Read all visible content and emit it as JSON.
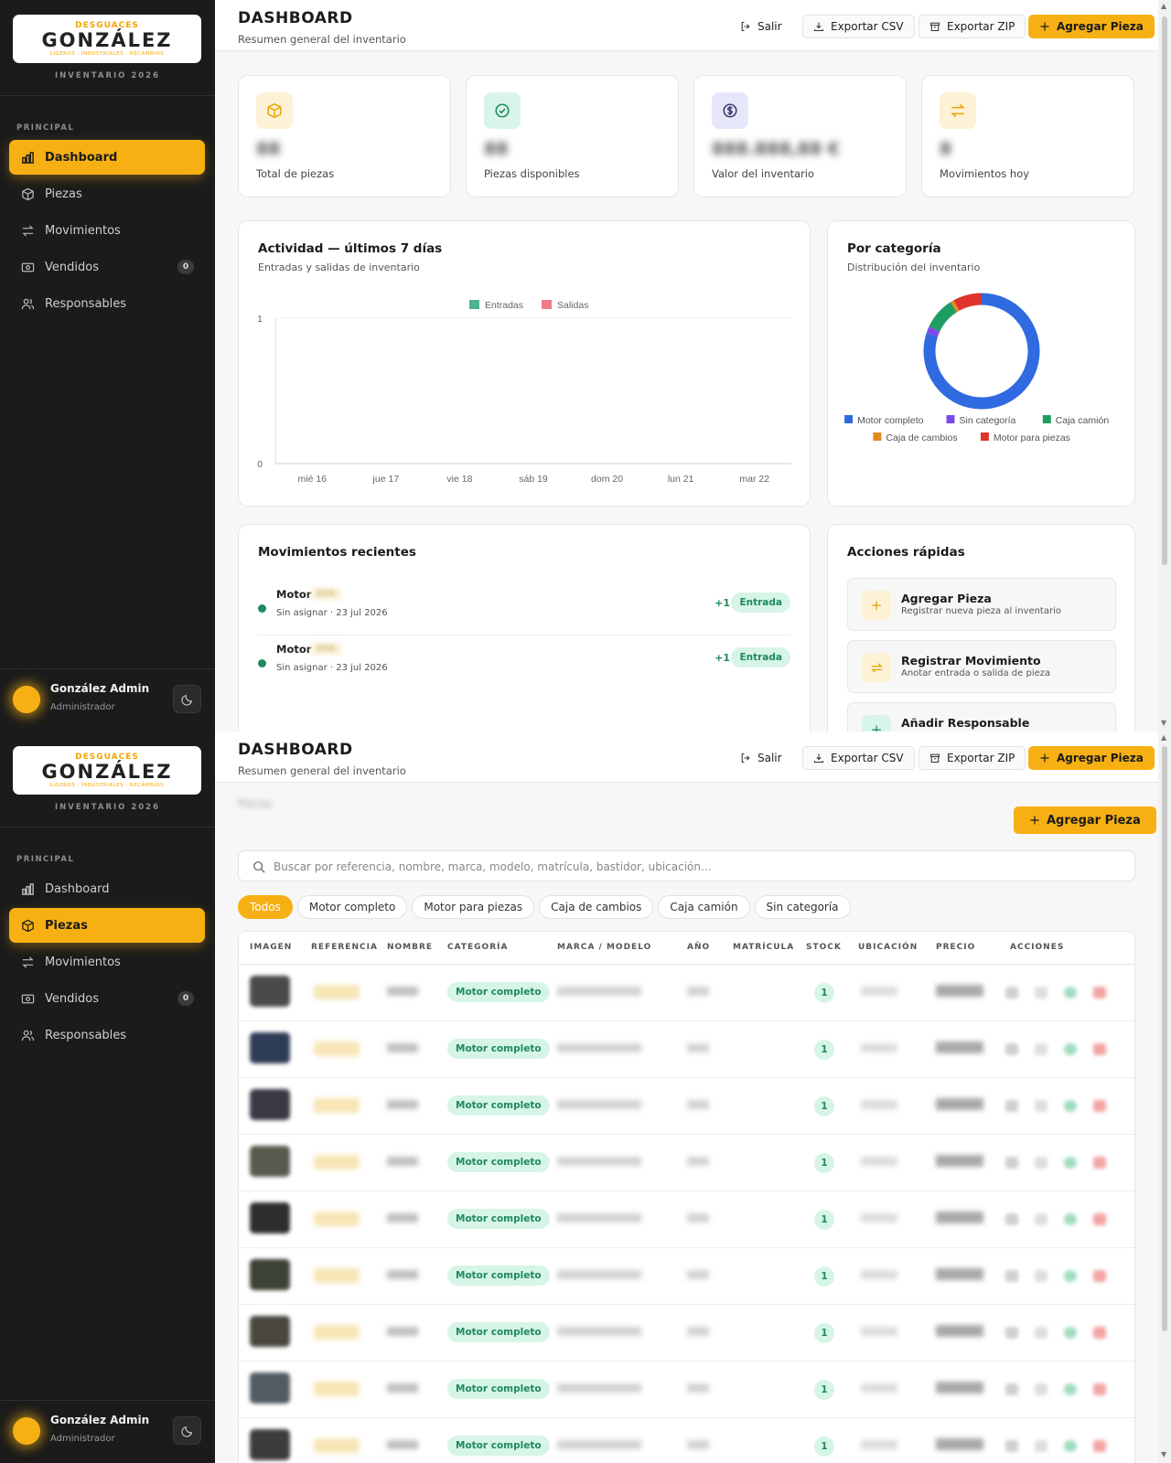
{
  "brand": {
    "top": "DESGUACES",
    "name": "GONZÁLEZ",
    "sub": "LIGEROS · INDUSTRIALES · RECAMBIOS",
    "tagline": "INVENTARIO 2026"
  },
  "sidebar": {
    "section": "PRINCIPAL",
    "items": [
      {
        "label": "Dashboard",
        "icon": "bar-chart-icon"
      },
      {
        "label": "Piezas",
        "icon": "box-icon"
      },
      {
        "label": "Movimientos",
        "icon": "arrows-exchange-icon"
      },
      {
        "label": "Vendidos",
        "icon": "cash-icon",
        "badge": "0"
      },
      {
        "label": "Responsables",
        "icon": "users-icon"
      }
    ],
    "user": {
      "name": "González Admin",
      "role": "Administrador"
    }
  },
  "topbar": {
    "title": "DASHBOARD",
    "subtitle": "Resumen general del inventario",
    "logout": "Salir",
    "export_csv": "Exportar CSV",
    "export_zip": "Exportar ZIP",
    "add": "Agregar Pieza"
  },
  "stats": [
    {
      "label": "Total de piezas",
      "value": "88",
      "icon": "cube-icon",
      "bg": "#fdf1d6",
      "fg": "#e8a400"
    },
    {
      "label": "Piezas disponibles",
      "value": "88",
      "icon": "check-circle-icon",
      "bg": "#d9f5e9",
      "fg": "#1f8a5b"
    },
    {
      "label": "Valor del inventario",
      "value": "888.888,88 €",
      "icon": "dollar-circle-icon",
      "bg": "#e6e8fa",
      "fg": "#3b3b6e"
    },
    {
      "label": "Movimientos hoy",
      "value": "8",
      "icon": "exchange-icon",
      "bg": "#fdf1d6",
      "fg": "#e8a400"
    }
  ],
  "activity": {
    "title": "Actividad — últimos 7 días",
    "subtitle": "Entradas y salidas de inventario"
  },
  "category": {
    "title": "Por categoría",
    "subtitle": "Distribución del inventario"
  },
  "chart_data": [
    {
      "type": "bar",
      "categories": [
        "mié 16",
        "jue 17",
        "vie 18",
        "sáb 19",
        "dom 20",
        "lun 21",
        "mar 22"
      ],
      "series": [
        {
          "name": "Entradas",
          "values": [
            0,
            0,
            0,
            0,
            0,
            0,
            0
          ],
          "color": "#4fb38e"
        },
        {
          "name": "Salidas",
          "values": [
            0,
            0,
            0,
            0,
            0,
            0,
            0
          ],
          "color": "#f07b86"
        }
      ],
      "ylim": [
        0,
        1
      ],
      "yticks": [
        "0",
        "1"
      ],
      "legend": "top-center"
    },
    {
      "type": "pie",
      "categories": [
        "Motor completo",
        "Sin categoría",
        "Caja camión",
        "Caja de cambios",
        "Motor para piezas"
      ],
      "values": [
        80,
        2,
        9,
        1,
        8
      ],
      "colors": [
        "#2f6ae0",
        "#7c4ae8",
        "#1f9e63",
        "#e58a1f",
        "#e0342c"
      ],
      "legend": "bottom"
    }
  ],
  "recent": {
    "title": "Movimientos recientes",
    "items": [
      {
        "name": "Motor",
        "meta": "Sin asignar · 23 jul 2026",
        "qty": "+1",
        "type": "Entrada"
      },
      {
        "name": "Motor",
        "meta": "Sin asignar · 23 jul 2026",
        "qty": "+1",
        "type": "Entrada"
      }
    ]
  },
  "quick": {
    "title": "Acciones rápidas",
    "items": [
      {
        "title": "Agregar Pieza",
        "desc": "Registrar nueva pieza al inventario",
        "icon": "plus-icon"
      },
      {
        "title": "Registrar Movimiento",
        "desc": "Anotar entrada o salida de pieza",
        "icon": "exchange-icon"
      },
      {
        "title": "Añadir Responsable",
        "desc": "",
        "icon": "plus-icon"
      }
    ]
  },
  "parts": {
    "crumb": "Piezas",
    "add": "Agregar Pieza",
    "search_placeholder": "Buscar por referencia, nombre, marca, modelo, matrícula, bastidor, ubicación...",
    "chips": [
      "Todos",
      "Motor completo",
      "Motor para piezas",
      "Caja de cambios",
      "Caja camión",
      "Sin categoría"
    ],
    "columns": [
      "IMAGEN",
      "REFERENCIA",
      "NOMBRE",
      "CATEGORÍA",
      "MARCA / MODELO",
      "AÑO",
      "MATRÍCULA",
      "STOCK",
      "UBICACIÓN",
      "PRECIO",
      "ACCIONES"
    ],
    "rows": [
      {
        "category": "Motor completo",
        "stock": "1",
        "img": "#4a4a4a"
      },
      {
        "category": "Motor completo",
        "stock": "1",
        "img": "#2f3c57"
      },
      {
        "category": "Motor completo",
        "stock": "1",
        "img": "#3a3a44"
      },
      {
        "category": "Motor completo",
        "stock": "1",
        "img": "#595a4e"
      },
      {
        "category": "Motor completo",
        "stock": "1",
        "img": "#2e2e2e"
      },
      {
        "category": "Motor completo",
        "stock": "1",
        "img": "#3c4234"
      },
      {
        "category": "Motor completo",
        "stock": "1",
        "img": "#4a4640"
      },
      {
        "category": "Motor completo",
        "stock": "1",
        "img": "#525a62"
      },
      {
        "category": "Motor completo",
        "stock": "1",
        "img": "#3c3c3c"
      }
    ]
  }
}
